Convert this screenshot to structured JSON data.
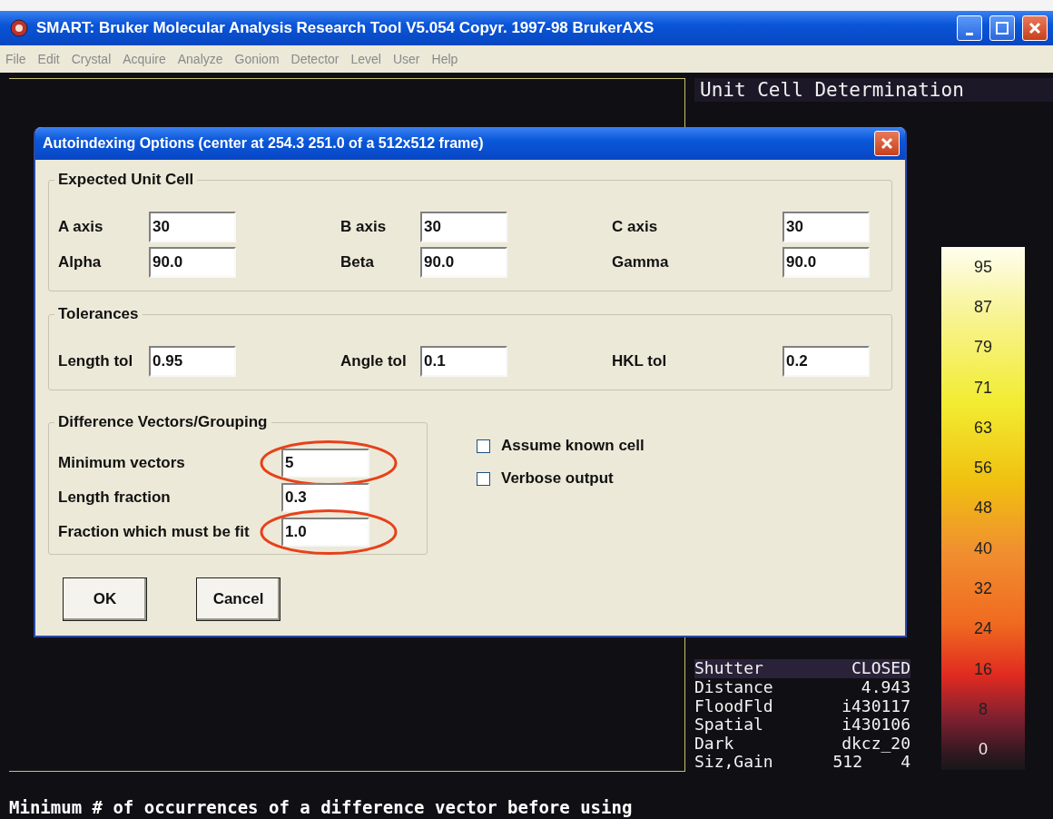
{
  "window": {
    "title": "SMART: Bruker Molecular Analysis Research Tool V5.054 Copyr. 1997-98 BrukerAXS"
  },
  "menu": [
    "File",
    "Edit",
    "Crystal",
    "Acquire",
    "Analyze",
    "Goniom",
    "Detector",
    "Level",
    "User",
    "Help"
  ],
  "panel": {
    "title": "Unit Cell Determination",
    "status": [
      {
        "label": "Shutter",
        "value": "CLOSED"
      },
      {
        "label": "Distance",
        "value": "4.943"
      },
      {
        "label": "FloodFld",
        "value": "i430117"
      },
      {
        "label": "Spatial",
        "value": "i430106"
      },
      {
        "label": "Dark",
        "value": "dkcz_20"
      },
      {
        "label": "Siz,Gain",
        "value": "512",
        "value_2": "4"
      }
    ],
    "scale": [
      "95",
      "87",
      "79",
      "71",
      "63",
      "56",
      "48",
      "40",
      "32",
      "24",
      "16",
      "8",
      "0"
    ]
  },
  "dialog": {
    "title": "Autoindexing Options (center at 254.3 251.0 of a 512x512 frame)",
    "groups": [
      {
        "title": "Expected Unit Cell",
        "rows": [
          [
            {
              "label": "A axis",
              "value": "30"
            },
            {
              "label": "B axis",
              "value": "30"
            },
            {
              "label": "C axis",
              "value": "30"
            }
          ],
          [
            {
              "label": "Alpha",
              "value": "90.0"
            },
            {
              "label": "Beta",
              "value": "90.0"
            },
            {
              "label": "Gamma",
              "value": "90.0"
            }
          ]
        ]
      },
      {
        "title": "Tolerances",
        "rows": [
          [
            {
              "label": "Length tol",
              "value": "0.95"
            },
            {
              "label": "Angle tol",
              "value": "0.1"
            },
            {
              "label": "HKL tol",
              "value": "0.2"
            }
          ]
        ]
      }
    ],
    "vectors": {
      "title": "Difference Vectors/Grouping",
      "fields": [
        {
          "label": "Minimum vectors",
          "value": "5",
          "circled": true
        },
        {
          "label": "Length fraction",
          "value": "0.3",
          "circled": false
        },
        {
          "label": "Fraction which must be fit",
          "value": "1.0",
          "circled": true
        }
      ]
    },
    "checkboxes": [
      {
        "label": "Assume known cell",
        "checked": false
      },
      {
        "label": "Verbose output",
        "checked": false
      }
    ],
    "buttons": [
      "OK",
      "Cancel"
    ]
  },
  "message": "Minimum # of occurrences of a difference vector before using"
}
